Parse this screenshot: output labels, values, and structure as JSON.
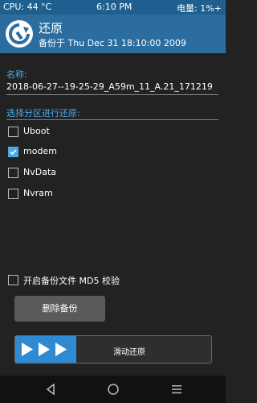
{
  "status": {
    "cpu": "CPU: 44 °C",
    "time": "6:10 PM",
    "battery": "电量: 1%+"
  },
  "header": {
    "title": "还原",
    "subtitle": "备份于 Thu Dec 31 18:10:00 2009",
    "icon": "restore-icon"
  },
  "name": {
    "label": "名称:",
    "value": "2018-06-27--19-25-29_A59m_11_A.21_171219"
  },
  "partitions": {
    "label": "选择分区进行还原:",
    "items": [
      {
        "label": "Uboot",
        "checked": false
      },
      {
        "label": "modem",
        "checked": true
      },
      {
        "label": "NvData",
        "checked": false
      },
      {
        "label": "Nvram",
        "checked": false
      }
    ]
  },
  "md5": {
    "label": "开启备份文件 MD5 校验",
    "checked": false
  },
  "delete_button": {
    "label": "删除备份"
  },
  "swipe": {
    "label": "滑动还原"
  },
  "colors": {
    "accent": "#2f8ad1",
    "header": "#2b6d9e",
    "background": "#222222"
  }
}
